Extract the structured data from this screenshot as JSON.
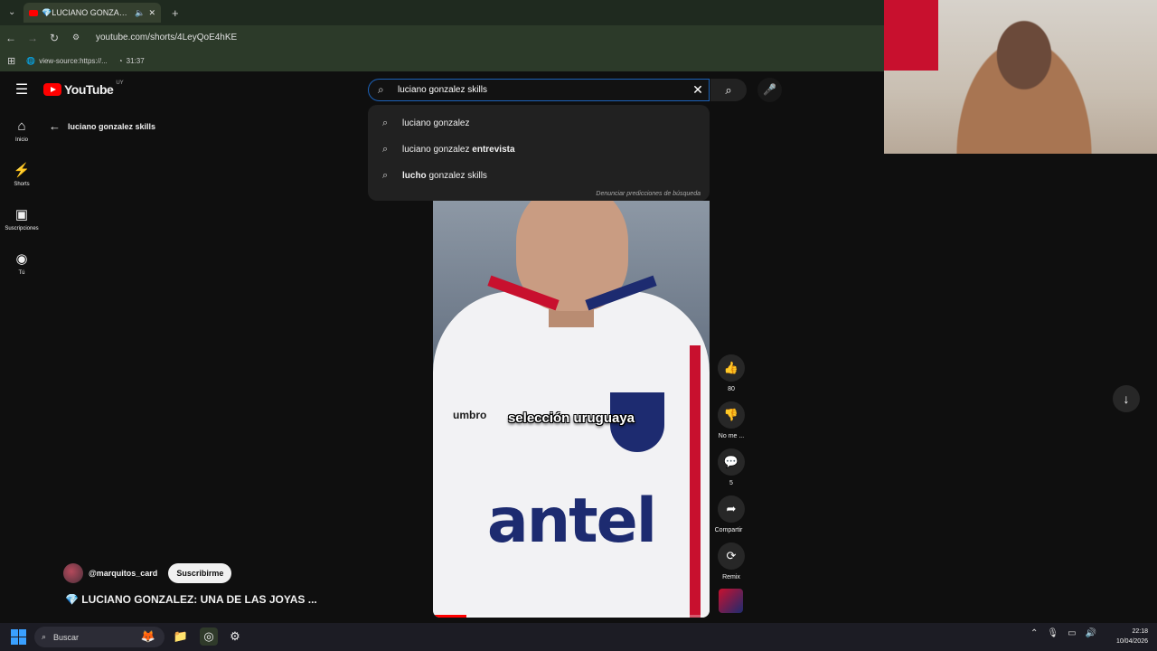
{
  "browser": {
    "tab_title": "💎LUCIANO GONZALEZ: U",
    "url": "youtube.com/shorts/4LeyQoE4hKE",
    "bookmarks": [
      {
        "label": "view-source:https://..."
      },
      {
        "label": "31:37"
      }
    ]
  },
  "youtube": {
    "logo_text": "YouTube",
    "country_code": "UY",
    "search": {
      "value": "luciano gonzalez skills"
    },
    "suggestions": [
      {
        "prefix": "luciano gonzalez",
        "bold": ""
      },
      {
        "prefix": "luciano gonzalez ",
        "bold": "entrevista"
      },
      {
        "prefix_bold": "lucho",
        "rest": " gonzalez skills"
      }
    ],
    "report_text": "Denunciar predicciones de búsqueda",
    "nav": [
      {
        "label": "Inicio",
        "icon": "home-icon"
      },
      {
        "label": "Shorts",
        "icon": "shorts-icon"
      },
      {
        "label": "Suscripciones",
        "icon": "subscriptions-icon"
      },
      {
        "label": "Tú",
        "icon": "user-icon"
      }
    ],
    "back_label": "luciano gonzalez skills"
  },
  "video": {
    "caption": "selección uruguaya",
    "sponsor": "antel",
    "brand": "umbro",
    "progress": 0.12
  },
  "actions": {
    "likes": "80",
    "dislike_label": "No me ...",
    "comments": "5",
    "share_label": "Compartir",
    "remix_label": "Remix"
  },
  "channel": {
    "handle": "@marquitos_card",
    "subscribe_label": "Suscribirme",
    "title": "LUCIANO GONZALEZ: UNA DE LAS JOYAS ..."
  },
  "taskbar": {
    "search_placeholder": "Buscar",
    "time": "22:18",
    "date": "10/04/2026"
  },
  "colors": {
    "accent": "#ff0000",
    "search_focus": "#1c62b9"
  }
}
